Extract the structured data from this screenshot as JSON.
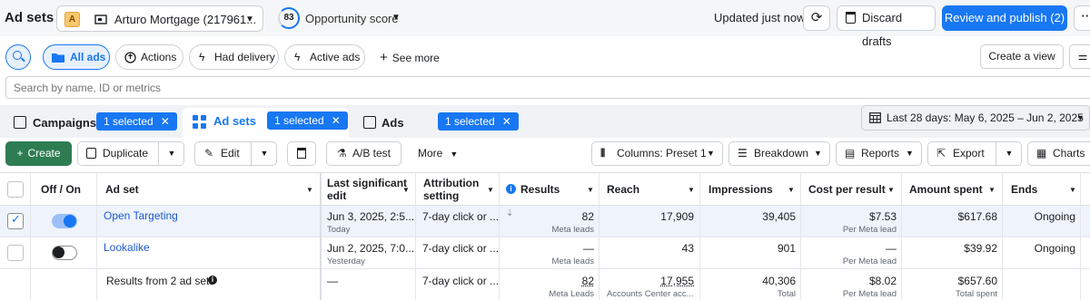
{
  "topbar": {
    "title": "Ad sets",
    "account_badge": "A",
    "account_name": "Arturo Mortgage (217961...",
    "opportunity_score": "83",
    "opportunity_label": "Opportunity score",
    "updated": "Updated just now",
    "discard_label": "Discard drafts",
    "publish_label": "Review and publish (2)",
    "more_label": "···"
  },
  "filters": {
    "pills": [
      "All ads",
      "Actions",
      "Had delivery",
      "Active ads"
    ],
    "see_more": "See more",
    "create_view": "Create a view",
    "search_placeholder": "Search by name, ID or metrics"
  },
  "tabs": {
    "campaigns": "Campaigns",
    "campaigns_selected": "1 selected",
    "adsets": "Ad sets",
    "adsets_selected": "1 selected",
    "ads": "Ads",
    "ads_selected": "1 selected",
    "date_range": "Last 28 days: May 6, 2025 – Jun 2, 2025"
  },
  "toolbar": {
    "create": "Create",
    "duplicate": "Duplicate",
    "edit": "Edit",
    "ab_test": "A/B test",
    "more": "More",
    "columns": "Columns: Preset 1",
    "breakdown": "Breakdown",
    "reports": "Reports",
    "export": "Export",
    "charts": "Charts"
  },
  "table": {
    "headers": {
      "off_on": "Off / On",
      "adset": "Ad set",
      "last_edit_1": "Last significant",
      "last_edit_2": "edit",
      "attribution_1": "Attribution",
      "attribution_2": "setting",
      "results": "Results",
      "reach": "Reach",
      "impressions": "Impressions",
      "cost": "Cost per result",
      "amount": "Amount spent",
      "ends": "Ends"
    },
    "rows": [
      {
        "name": "Open Targeting",
        "edit": "Jun 3, 2025, 2:5...",
        "edit_sub": "Today",
        "attribution": "7-day click or ...",
        "results": "82",
        "results_sub": "Meta leads",
        "reach": "17,909",
        "impressions": "39,405",
        "cost": "$7.53",
        "cost_sub": "Per Meta lead",
        "amount": "$617.68",
        "ends": "Ongoing"
      },
      {
        "name": "Lookalike",
        "edit": "Jun 2, 2025, 7:0...",
        "edit_sub": "Yesterday",
        "attribution": "7-day click or ...",
        "results": "—",
        "results_sub": "Meta leads",
        "reach": "43",
        "impressions": "901",
        "cost": "—",
        "cost_sub": "Per Meta lead",
        "amount": "$39.92",
        "ends": "Ongoing"
      }
    ],
    "summary": {
      "label": "Results from 2 ad sets",
      "edit": "—",
      "attribution": "7-day click or ...",
      "results": "82",
      "results_sub": "Meta Leads",
      "reach": "17,955",
      "reach_sub": "Accounts Center acc...",
      "impressions": "40,306",
      "impressions_sub": "Total",
      "cost": "$8.02",
      "cost_sub": "Per Meta lead",
      "amount": "$657.60",
      "amount_sub": "Total spent"
    }
  }
}
